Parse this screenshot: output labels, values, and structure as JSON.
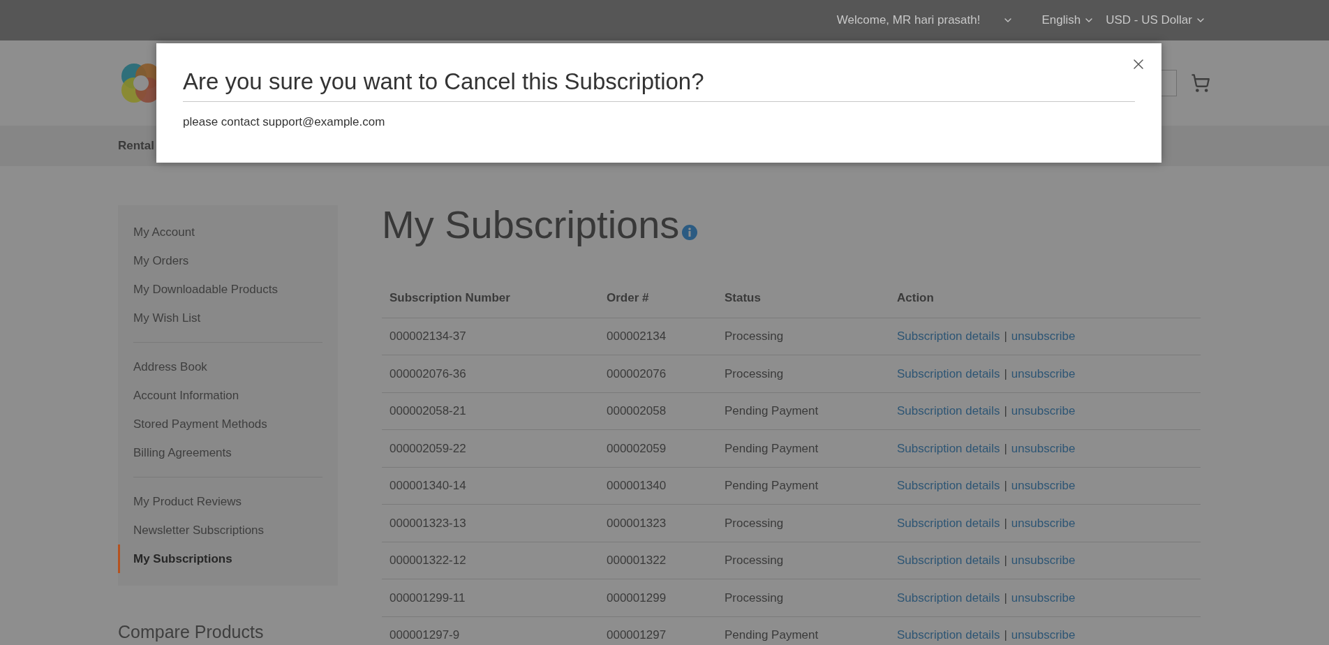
{
  "top_bar": {
    "welcome": "Welcome, MR hari prasath!",
    "language": "English",
    "currency": "USD - US Dollar"
  },
  "nav": {
    "items": [
      "Rental"
    ]
  },
  "sidebar": {
    "groups": [
      [
        {
          "label": "My Account",
          "selected": false
        },
        {
          "label": "My Orders",
          "selected": false
        },
        {
          "label": "My Downloadable Products",
          "selected": false
        },
        {
          "label": "My Wish List",
          "selected": false
        }
      ],
      [
        {
          "label": "Address Book",
          "selected": false
        },
        {
          "label": "Account Information",
          "selected": false
        },
        {
          "label": "Stored Payment Methods",
          "selected": false
        },
        {
          "label": "Billing Agreements",
          "selected": false
        }
      ],
      [
        {
          "label": "My Product Reviews",
          "selected": false
        },
        {
          "label": "Newsletter Subscriptions",
          "selected": false
        },
        {
          "label": "My Subscriptions",
          "selected": true
        }
      ]
    ],
    "compare_title": "Compare Products"
  },
  "page_title": "My Subscriptions",
  "table": {
    "columns": [
      "Subscription Number",
      "Order #",
      "Status",
      "Action"
    ],
    "rows": [
      {
        "number": "000002134-37",
        "order": "000002134",
        "status": "Processing",
        "details": "Subscription details",
        "separator": "|",
        "unsubscribe": "unsubscribe"
      },
      {
        "number": "000002076-36",
        "order": "000002076",
        "status": "Processing",
        "details": "Subscription details",
        "separator": "|",
        "unsubscribe": "unsubscribe"
      },
      {
        "number": "000002058-21",
        "order": "000002058",
        "status": "Pending Payment",
        "details": "Subscription details",
        "separator": "|",
        "unsubscribe": "unsubscribe"
      },
      {
        "number": "000002059-22",
        "order": "000002059",
        "status": "Pending Payment",
        "details": "Subscription details",
        "separator": "|",
        "unsubscribe": "unsubscribe"
      },
      {
        "number": "000001340-14",
        "order": "000001340",
        "status": "Pending Payment",
        "details": "Subscription details",
        "separator": "|",
        "unsubscribe": "unsubscribe"
      },
      {
        "number": "000001323-13",
        "order": "000001323",
        "status": "Processing",
        "details": "Subscription details",
        "separator": "|",
        "unsubscribe": "unsubscribe"
      },
      {
        "number": "000001322-12",
        "order": "000001322",
        "status": "Processing",
        "details": "Subscription details",
        "separator": "|",
        "unsubscribe": "unsubscribe"
      },
      {
        "number": "000001299-11",
        "order": "000001299",
        "status": "Processing",
        "details": "Subscription details",
        "separator": "|",
        "unsubscribe": "unsubscribe"
      },
      {
        "number": "000001297-9",
        "order": "000001297",
        "status": "Pending Payment",
        "details": "Subscription details",
        "separator": "|",
        "unsubscribe": "unsubscribe"
      }
    ]
  },
  "modal": {
    "title": "Are you sure you want to Cancel this Subscription?",
    "body": "please contact support@example.com"
  }
}
